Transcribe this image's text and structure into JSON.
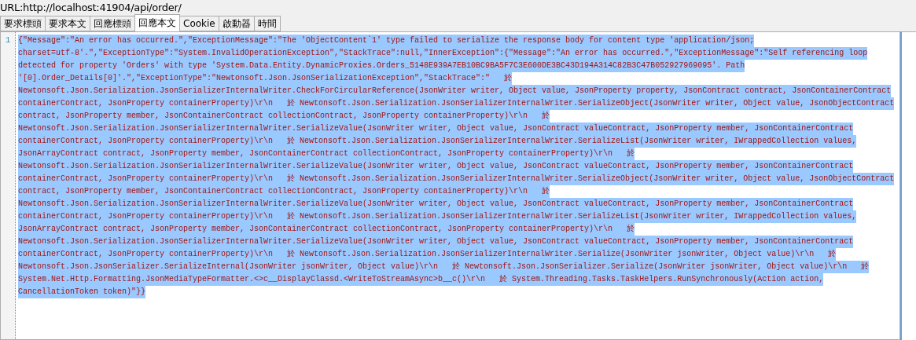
{
  "url_bar": {
    "label": "URL:http://localhost:41904/api/order/"
  },
  "tabs": [
    {
      "label": "要求標頭",
      "selected": false
    },
    {
      "label": "要求本文",
      "selected": false
    },
    {
      "label": "回應標頭",
      "selected": false
    },
    {
      "label": "回應本文",
      "selected": true
    },
    {
      "label": "Cookie",
      "selected": false
    },
    {
      "label": "啟動器",
      "selected": false
    },
    {
      "label": "時間",
      "selected": false
    }
  ],
  "editor": {
    "line_number": "1",
    "selected": true,
    "lines": [
      "{\"Message\":\"An error has occurred.\",\"ExceptionMessage\":\"The 'ObjectContent`1' type failed to serialize the response body for content type 'application/json;",
      "charset=utf-8'.\",\"ExceptionType\":\"System.InvalidOperationException\",\"StackTrace\":null,\"InnerException\":{\"Message\":\"An error has occurred.\",\"ExceptionMessage\":\"Self referencing loop",
      "detected for property 'Orders' with type 'System.Data.Entity.DynamicProxies.Orders_5148E939A7EB10BC9BA5F7C3E600DE3BC43D194A314C82B3C47B052927969095'. Path",
      "'[0].Order_Details[0]'.\",\"ExceptionType\":\"Newtonsoft.Json.JsonSerializationException\",\"StackTrace\":\"   於",
      "Newtonsoft.Json.Serialization.JsonSerializerInternalWriter.CheckForCircularReference(JsonWriter writer, Object value, JsonProperty property, JsonContract contract, JsonContainerContract",
      "containerContract, JsonProperty containerProperty)\\r\\n   於 Newtonsoft.Json.Serialization.JsonSerializerInternalWriter.SerializeObject(JsonWriter writer, Object value, JsonObjectContract",
      "contract, JsonProperty member, JsonContainerContract collectionContract, JsonProperty containerProperty)\\r\\n   於",
      "Newtonsoft.Json.Serialization.JsonSerializerInternalWriter.SerializeValue(JsonWriter writer, Object value, JsonContract valueContract, JsonProperty member, JsonContainerContract",
      "containerContract, JsonProperty containerProperty)\\r\\n   於 Newtonsoft.Json.Serialization.JsonSerializerInternalWriter.SerializeList(JsonWriter writer, IWrappedCollection values,",
      "JsonArrayContract contract, JsonProperty member, JsonContainerContract collectionContract, JsonProperty containerProperty)\\r\\n   於",
      "Newtonsoft.Json.Serialization.JsonSerializerInternalWriter.SerializeValue(JsonWriter writer, Object value, JsonContract valueContract, JsonProperty member, JsonContainerContract",
      "containerContract, JsonProperty containerProperty)\\r\\n   於 Newtonsoft.Json.Serialization.JsonSerializerInternalWriter.SerializeObject(JsonWriter writer, Object value, JsonObjectContract",
      "contract, JsonProperty member, JsonContainerContract collectionContract, JsonProperty containerProperty)\\r\\n   於",
      "Newtonsoft.Json.Serialization.JsonSerializerInternalWriter.SerializeValue(JsonWriter writer, Object value, JsonContract valueContract, JsonProperty member, JsonContainerContract",
      "containerContract, JsonProperty containerProperty)\\r\\n   於 Newtonsoft.Json.Serialization.JsonSerializerInternalWriter.SerializeList(JsonWriter writer, IWrappedCollection values,",
      "JsonArrayContract contract, JsonProperty member, JsonContainerContract collectionContract, JsonProperty containerProperty)\\r\\n   於",
      "Newtonsoft.Json.Serialization.JsonSerializerInternalWriter.SerializeValue(JsonWriter writer, Object value, JsonContract valueContract, JsonProperty member, JsonContainerContract",
      "containerContract, JsonProperty containerProperty)\\r\\n   於 Newtonsoft.Json.Serialization.JsonSerializerInternalWriter.Serialize(JsonWriter jsonWriter, Object value)\\r\\n   於",
      "Newtonsoft.Json.JsonSerializer.SerializeInternal(JsonWriter jsonWriter, Object value)\\r\\n   於 Newtonsoft.Json.JsonSerializer.Serialize(JsonWriter jsonWriter, Object value)\\r\\n   於",
      "System.Net.Http.Formatting.JsonMediaTypeFormatter.<>c__DisplayClassd.<WriteToStreamAsync>b__c()\\r\\n   於 System.Threading.Tasks.TaskHelpers.RunSynchronously(Action action,",
      "CancellationToken token)\"}}"
    ]
  }
}
